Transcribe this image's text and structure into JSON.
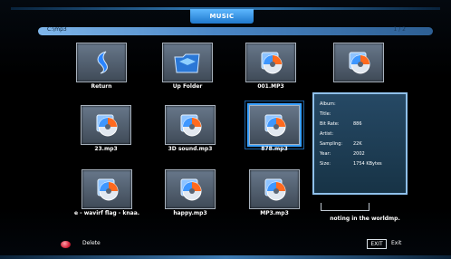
{
  "header": {
    "title": "MUSIC"
  },
  "path": {
    "value": "C:\\mp3",
    "page": "1 / 2"
  },
  "grid": [
    {
      "label": "Return",
      "icon": "return-arrow-icon"
    },
    {
      "label": "Up Folder",
      "icon": "up-folder-icon"
    },
    {
      "label": "001.MP3",
      "icon": "music-disc-icon"
    },
    {
      "label": "",
      "icon": "music-disc-icon"
    },
    {
      "label": "23.mp3",
      "icon": "music-disc-icon"
    },
    {
      "label": "3D sound.mp3",
      "icon": "music-disc-icon"
    },
    {
      "label": "878.mp3",
      "icon": "music-disc-icon",
      "selected": true
    },
    {
      "label": "e - wavirf flag - knaa.",
      "icon": "music-disc-icon"
    },
    {
      "label": "happy.mp3",
      "icon": "music-disc-icon"
    },
    {
      "label": "MP3.mp3",
      "icon": "music-disc-icon"
    }
  ],
  "info": {
    "rows": [
      {
        "key": "Album:",
        "value": ""
      },
      {
        "key": "Title:",
        "value": ""
      },
      {
        "key": "Bit Rate:",
        "value": "886"
      },
      {
        "key": "Artist:",
        "value": ""
      },
      {
        "key": "Sampling:",
        "value": "22K"
      },
      {
        "key": "Year:",
        "value": "2002"
      },
      {
        "key": "Size:",
        "value": "1754 KBytes"
      }
    ],
    "caption": "noting in the worldmp."
  },
  "footer": {
    "delete_label": "Delete",
    "exit_key": "EXIT",
    "exit_label": "Exit"
  },
  "colors": {
    "accent": "#39a0ff",
    "info_bg": "#1f405a",
    "delete_red": "#d4233a"
  }
}
